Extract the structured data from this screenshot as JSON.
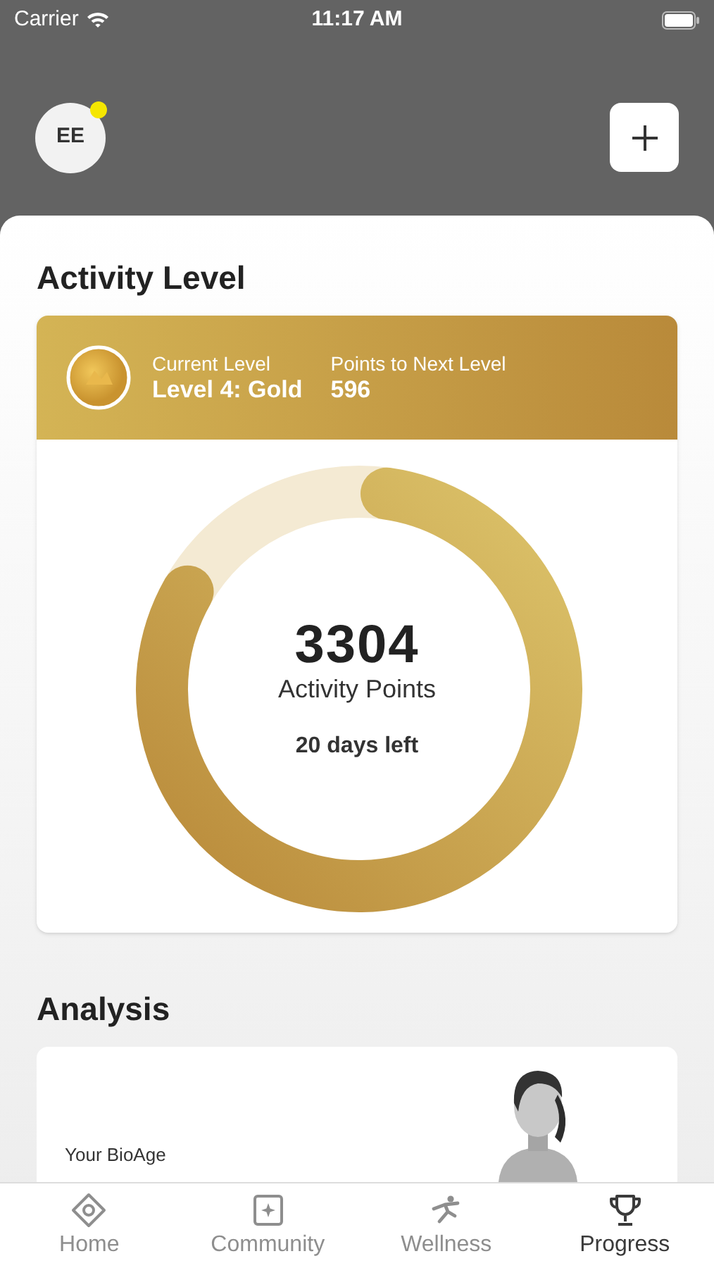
{
  "status_bar": {
    "carrier": "Carrier",
    "time": "11:17 AM"
  },
  "header": {
    "avatar_initials": "EE",
    "notification_dot": true
  },
  "activity": {
    "title": "Activity Level",
    "current_level_label": "Current Level",
    "current_level": "Level 4: Gold",
    "points_label": "Points to Next Level",
    "points": "596",
    "total": "3304",
    "total_label": "Activity Points",
    "days_left": "20 days left"
  },
  "analysis": {
    "title": "Analysis",
    "card_text": "Your BioAge"
  },
  "tabs": [
    {
      "label": "Home",
      "kind": "home",
      "selected": false
    },
    {
      "label": "Community",
      "kind": "community",
      "selected": false
    },
    {
      "label": "Wellness",
      "kind": "wellness",
      "selected": false
    },
    {
      "label": "Progress",
      "kind": "progress",
      "selected": true
    }
  ]
}
